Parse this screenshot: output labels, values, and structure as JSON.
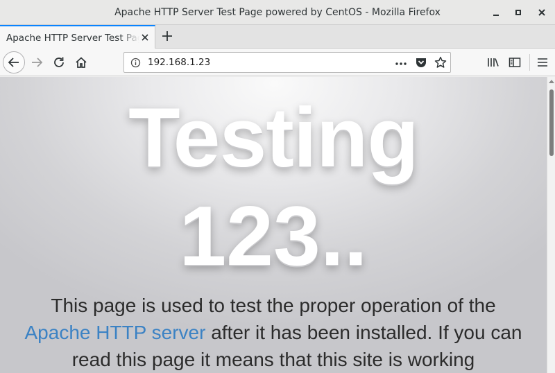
{
  "window": {
    "title": "Apache HTTP Server Test Page powered by CentOS - Mozilla Firefox"
  },
  "tabs": [
    {
      "label": "Apache HTTP Server Test Page powered by CentOS"
    }
  ],
  "navbar": {
    "url": "192.168.1.23"
  },
  "page": {
    "headline_line1": "Testing",
    "headline_line2": "123..",
    "para_before_link": "This page is used to test the proper operation of the ",
    "para_link": "Apache HTTP server",
    "para_after_link": " after it has been installed. If you can read this page it means that this site is working"
  },
  "colors": {
    "tab_accent": "#0a84ff",
    "link": "#3b82c4"
  },
  "icons": [
    "minimize-icon",
    "maximize-icon",
    "close-icon",
    "tab-close-icon",
    "plus-icon",
    "back-arrow-icon",
    "forward-arrow-icon",
    "reload-icon",
    "home-icon",
    "info-icon",
    "more-dots-icon",
    "pocket-icon",
    "star-icon",
    "library-icon",
    "sidebar-icon",
    "hamburger-menu-icon"
  ]
}
